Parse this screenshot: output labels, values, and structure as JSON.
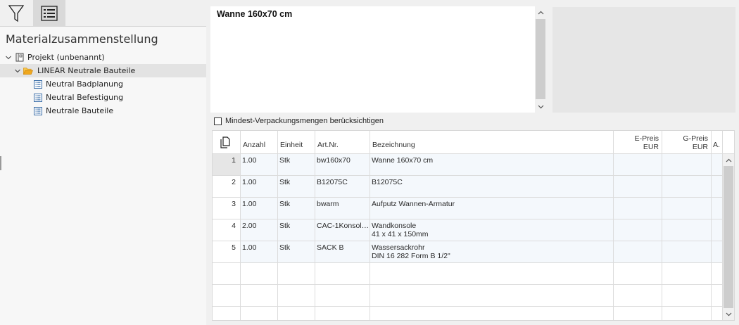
{
  "left_panel": {
    "title": "Materialzusammenstellung",
    "toolbar": [
      {
        "name": "filter",
        "icon": "funnel-icon",
        "active": false
      },
      {
        "name": "list",
        "icon": "list-view-icon",
        "active": true
      }
    ],
    "tree": [
      {
        "label": "Projekt (unbenannt)",
        "level": 0,
        "icon": "project-icon",
        "expanded": true,
        "selected": false
      },
      {
        "label": "LINEAR Neutrale Bauteile",
        "level": 1,
        "icon": "folder-open-icon",
        "expanded": true,
        "selected": true
      },
      {
        "label": "Neutral Badplanung",
        "level": 2,
        "icon": "list-doc-icon",
        "expanded": false,
        "selected": false
      },
      {
        "label": "Neutral Befestigung",
        "level": 2,
        "icon": "list-doc-icon",
        "expanded": false,
        "selected": false
      },
      {
        "label": "Neutrale Bauteile",
        "level": 2,
        "icon": "list-doc-icon",
        "expanded": false,
        "selected": false
      }
    ]
  },
  "description": {
    "title": "Wanne 160x70 cm"
  },
  "packaging": {
    "label": "Mindest-Verpackungsmengen berücksichtigen",
    "checked": false
  },
  "table": {
    "headers": {
      "anzahl": "Anzahl",
      "einheit": "Einheit",
      "artnr": "Art.Nr.",
      "bezeichnung": "Bezeichnung",
      "epreis_1": "E-Preis",
      "epreis_2": "EUR",
      "gpreis_1": "G-Preis",
      "gpreis_2": "EUR",
      "a": "A."
    },
    "rows": [
      {
        "idx": "1",
        "anzahl": "1.00",
        "einheit": "Stk",
        "artnr": "bw160x70",
        "bez1": "Wanne 160x70 cm",
        "bez2": ""
      },
      {
        "idx": "2",
        "anzahl": "1.00",
        "einheit": "Stk",
        "artnr": "B12075C",
        "bez1": "B12075C",
        "bez2": ""
      },
      {
        "idx": "3",
        "anzahl": "1.00",
        "einheit": "Stk",
        "artnr": "bwarm",
        "bez1": "Aufputz Wannen-Armatur",
        "bez2": ""
      },
      {
        "idx": "4",
        "anzahl": "2.00",
        "einheit": "Stk",
        "artnr": "CAC-1Konsole...",
        "bez1": "Wandkonsole",
        "bez2": "41 x 41 x 150mm"
      },
      {
        "idx": "5",
        "anzahl": "1.00",
        "einheit": "Stk",
        "artnr": "SACK B",
        "bez1": "Wassersackrohr",
        "bez2": "DIN 16 282 Form B 1/2\""
      }
    ],
    "active_row": "1"
  },
  "colors": {
    "selection": "#e3e3e3",
    "folder": "#f0a81e",
    "list_icon": "#3b6ea8",
    "data_cell": "#f4f8fc"
  }
}
